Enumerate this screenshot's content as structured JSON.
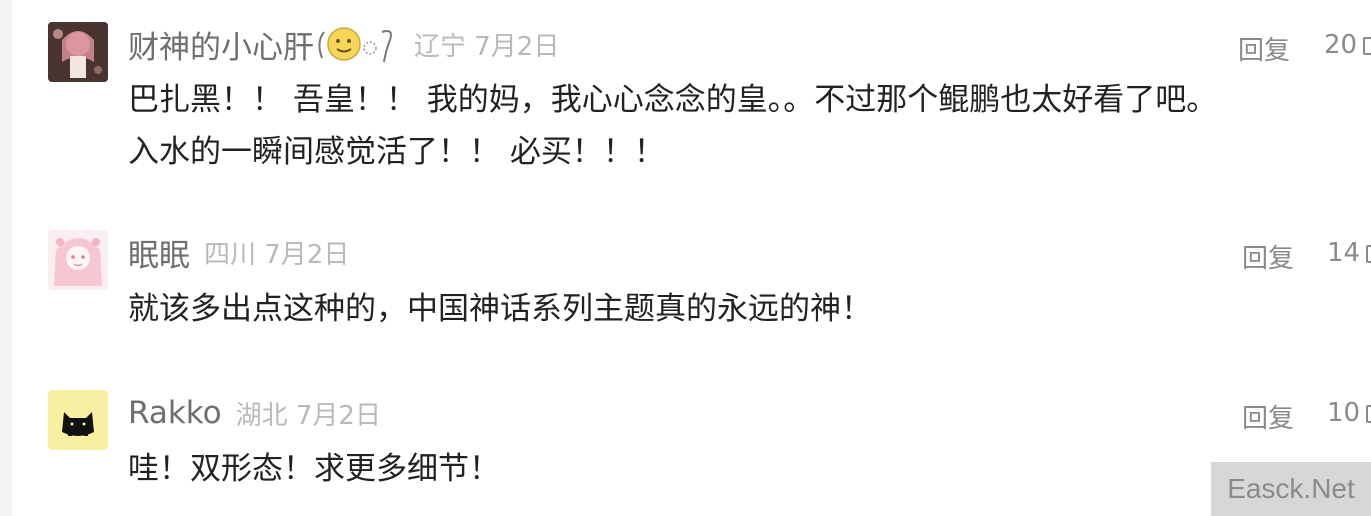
{
  "comments": [
    {
      "username": "财神的小心肝",
      "location_date": "辽宁 7月2日",
      "reply_label": "回复",
      "likes": "20",
      "lines": [
        "巴扎黑！！ 吾皇！！ 我的妈，我心心念念的皇。。不过那个鲲鹏也太好看了吧。",
        "入水的一瞬间感觉活了！！ 必买！！！"
      ]
    },
    {
      "username": "眠眠",
      "location_date": "四川 7月2日",
      "reply_label": "回复",
      "likes": "14",
      "lines": [
        "就该多出点这种的，中国神话系列主题真的永远的神！"
      ]
    },
    {
      "username": "Rakko",
      "location_date": "湖北 7月2日",
      "reply_label": "回复",
      "likes": "10",
      "lines": [
        "哇！双形态！求更多细节！"
      ]
    }
  ],
  "watermark": "Easck.Net",
  "icons": {
    "emoji": "smiling-moon-emoji-icon",
    "like": "like-icon"
  }
}
